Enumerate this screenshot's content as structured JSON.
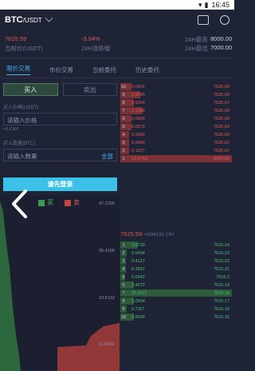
{
  "status": {
    "time": "16:45"
  },
  "header": {
    "pair": "BTC",
    "quote": "/USDT"
  },
  "ticker": {
    "last_price": "7625.59",
    "change": "-3.94%",
    "high_label": "24H最高",
    "high_value": "8000.00",
    "cny_label": "当前价(USDT)",
    "change_label": "24H涨跌幅",
    "low_label": "24H最低",
    "low_value": "7000.00"
  },
  "tabs": [
    "限价交易",
    "市价交易",
    "当前委托",
    "历史委托"
  ],
  "form": {
    "buy_label": "买入",
    "sell_label": "卖出",
    "price_label": "买入价格(USDT)",
    "price_placeholder": "请输入价格",
    "price_sub": "≈0 CNY",
    "amount_label": "买入数量(BTC)",
    "amount_placeholder": "请输入数量",
    "all_label": "全部",
    "login_label": "请先登录"
  },
  "depth_chart": {
    "buy_legend": "买",
    "sell_legend": "卖",
    "axis_ticks": [
      "47.2265",
      "35.4196",
      "23.6132",
      "11.8066"
    ]
  },
  "mid_price": {
    "price": "7625.59",
    "sub": "≈53843.81 CNY"
  },
  "asks": [
    {
      "n": "10",
      "qty": "0.0451",
      "price": "7625.69",
      "depth": 0.1
    },
    {
      "n": "9",
      "qty": "1.3485",
      "price": "7625.68",
      "depth": 0.18
    },
    {
      "n": "8",
      "qty": "0.5024",
      "price": "7625.67",
      "depth": 0.12
    },
    {
      "n": "7",
      "qty": "1.2168",
      "price": "7625.66",
      "depth": 0.2
    },
    {
      "n": "6",
      "qty": "0.0806",
      "price": "7625.65",
      "depth": 0.1
    },
    {
      "n": "5",
      "qty": "0.0570",
      "price": "7625.64",
      "depth": 0.1
    },
    {
      "n": "4",
      "qty": "0.0091",
      "price": "7625.63",
      "depth": 0.08
    },
    {
      "n": "3",
      "qty": "0.0455",
      "price": "7625.62",
      "depth": 0.08
    },
    {
      "n": "2",
      "qty": "0.1027",
      "price": "7625.61",
      "depth": 0.08
    },
    {
      "n": "1",
      "qty": "13.4755",
      "price": "8000.00",
      "depth": 1.0
    }
  ],
  "bids": [
    {
      "n": "1",
      "qty": "3.5739",
      "price": "7616.24",
      "depth": 0.16
    },
    {
      "n": "2",
      "qty": "0.6494",
      "price": "7616.23",
      "depth": 0.06
    },
    {
      "n": "3",
      "qty": "0.4127",
      "price": "7616.22",
      "depth": 0.05
    },
    {
      "n": "4",
      "qty": "0.3561",
      "price": "7616.21",
      "depth": 0.05
    },
    {
      "n": "5",
      "qty": "0.0942",
      "price": "7616.2",
      "depth": 0.04
    },
    {
      "n": "6",
      "qty": "2.4672",
      "price": "7616.19",
      "depth": 0.12
    },
    {
      "n": "7",
      "qty": "22.0117",
      "price": "7616.18",
      "depth": 1.0
    },
    {
      "n": "8",
      "qty": "2.0934",
      "price": "7616.17",
      "depth": 0.12
    },
    {
      "n": "9",
      "qty": "0.7117",
      "price": "7616.16",
      "depth": 0.06
    },
    {
      "n": "10",
      "qty": "2.6004",
      "price": "7616.15",
      "depth": 0.12
    }
  ]
}
